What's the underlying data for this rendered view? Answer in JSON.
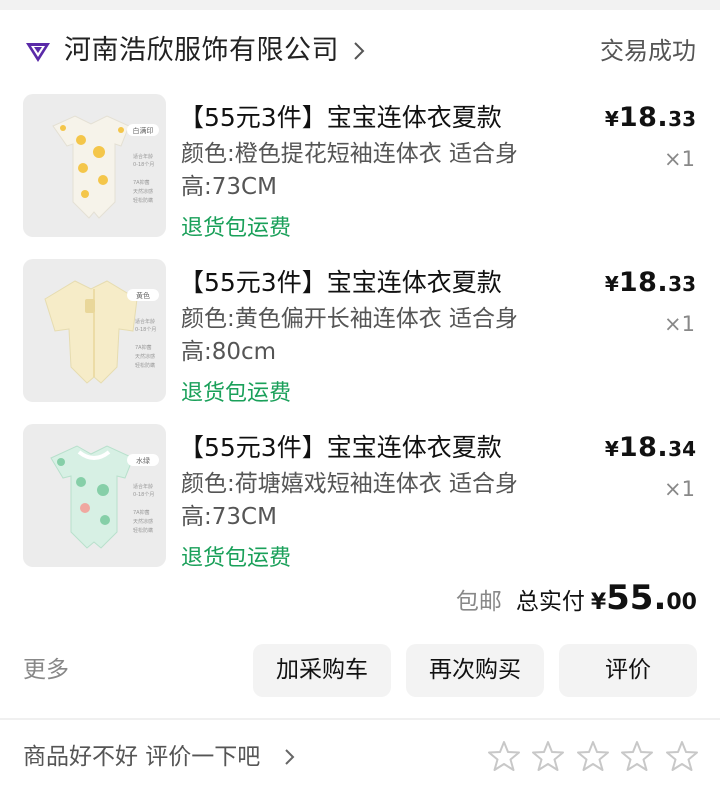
{
  "shop": {
    "name": "河南浩欣服饰有限公司",
    "status": "交易成功"
  },
  "items": [
    {
      "title": "【55元3件】宝宝连体衣夏款",
      "spec": "颜色:橙色提花短袖连体衣 适合身高:73CM",
      "tag": "退货包运费",
      "price_symbol": "¥",
      "price_int": "18.",
      "price_dec": "33",
      "qty": "×1",
      "thumb_badge": "白满印",
      "thumb_lines": [
        "适合年龄",
        "0-18个月",
        "7A抑菌",
        "天然凉感",
        "轻松防螨"
      ],
      "colors": {
        "garment": "#f6f3ea",
        "pattern": "#f4c64a",
        "bg": "#ececec"
      }
    },
    {
      "title": "【55元3件】宝宝连体衣夏款",
      "spec": "颜色:黄色偏开长袖连体衣 适合身高:80cm",
      "tag": "退货包运费",
      "price_symbol": "¥",
      "price_int": "18.",
      "price_dec": "33",
      "qty": "×1",
      "thumb_badge": "黄色",
      "thumb_lines": [
        "适合年龄",
        "0-18个月",
        "7A抑菌",
        "天然凉感",
        "轻松防螨"
      ],
      "colors": {
        "garment": "#f6ecc8",
        "pattern": "#e9d79a",
        "bg": "#ececec"
      }
    },
    {
      "title": "【55元3件】宝宝连体衣夏款",
      "spec": "颜色:荷塘嬉戏短袖连体衣 适合身高:73CM",
      "tag": "退货包运费",
      "price_symbol": "¥",
      "price_int": "18.",
      "price_dec": "34",
      "qty": "×1",
      "thumb_badge": "水绿",
      "thumb_lines": [
        "适合年龄",
        "0-18个月",
        "7A抑菌",
        "天然凉感",
        "轻松防螨"
      ],
      "colors": {
        "garment": "#d7f0e4",
        "pattern": "#86cfa8",
        "bg": "#ececec"
      }
    }
  ],
  "summary": {
    "shipping": "包邮",
    "total_label": "总实付",
    "total_symbol": "¥",
    "total_int": "55.",
    "total_dec": "00"
  },
  "actions": {
    "more": "更多",
    "add_cart": "加采购车",
    "rebuy": "再次购买",
    "review": "评价"
  },
  "review_bar": {
    "prompt": "商品好不好 评价一下吧",
    "star_count": 5,
    "rating": 0
  },
  "theme": {
    "accent_green": "#1aa05a",
    "logo_purple": "#5a2aa8",
    "star_outline": "#c8c8c8"
  }
}
